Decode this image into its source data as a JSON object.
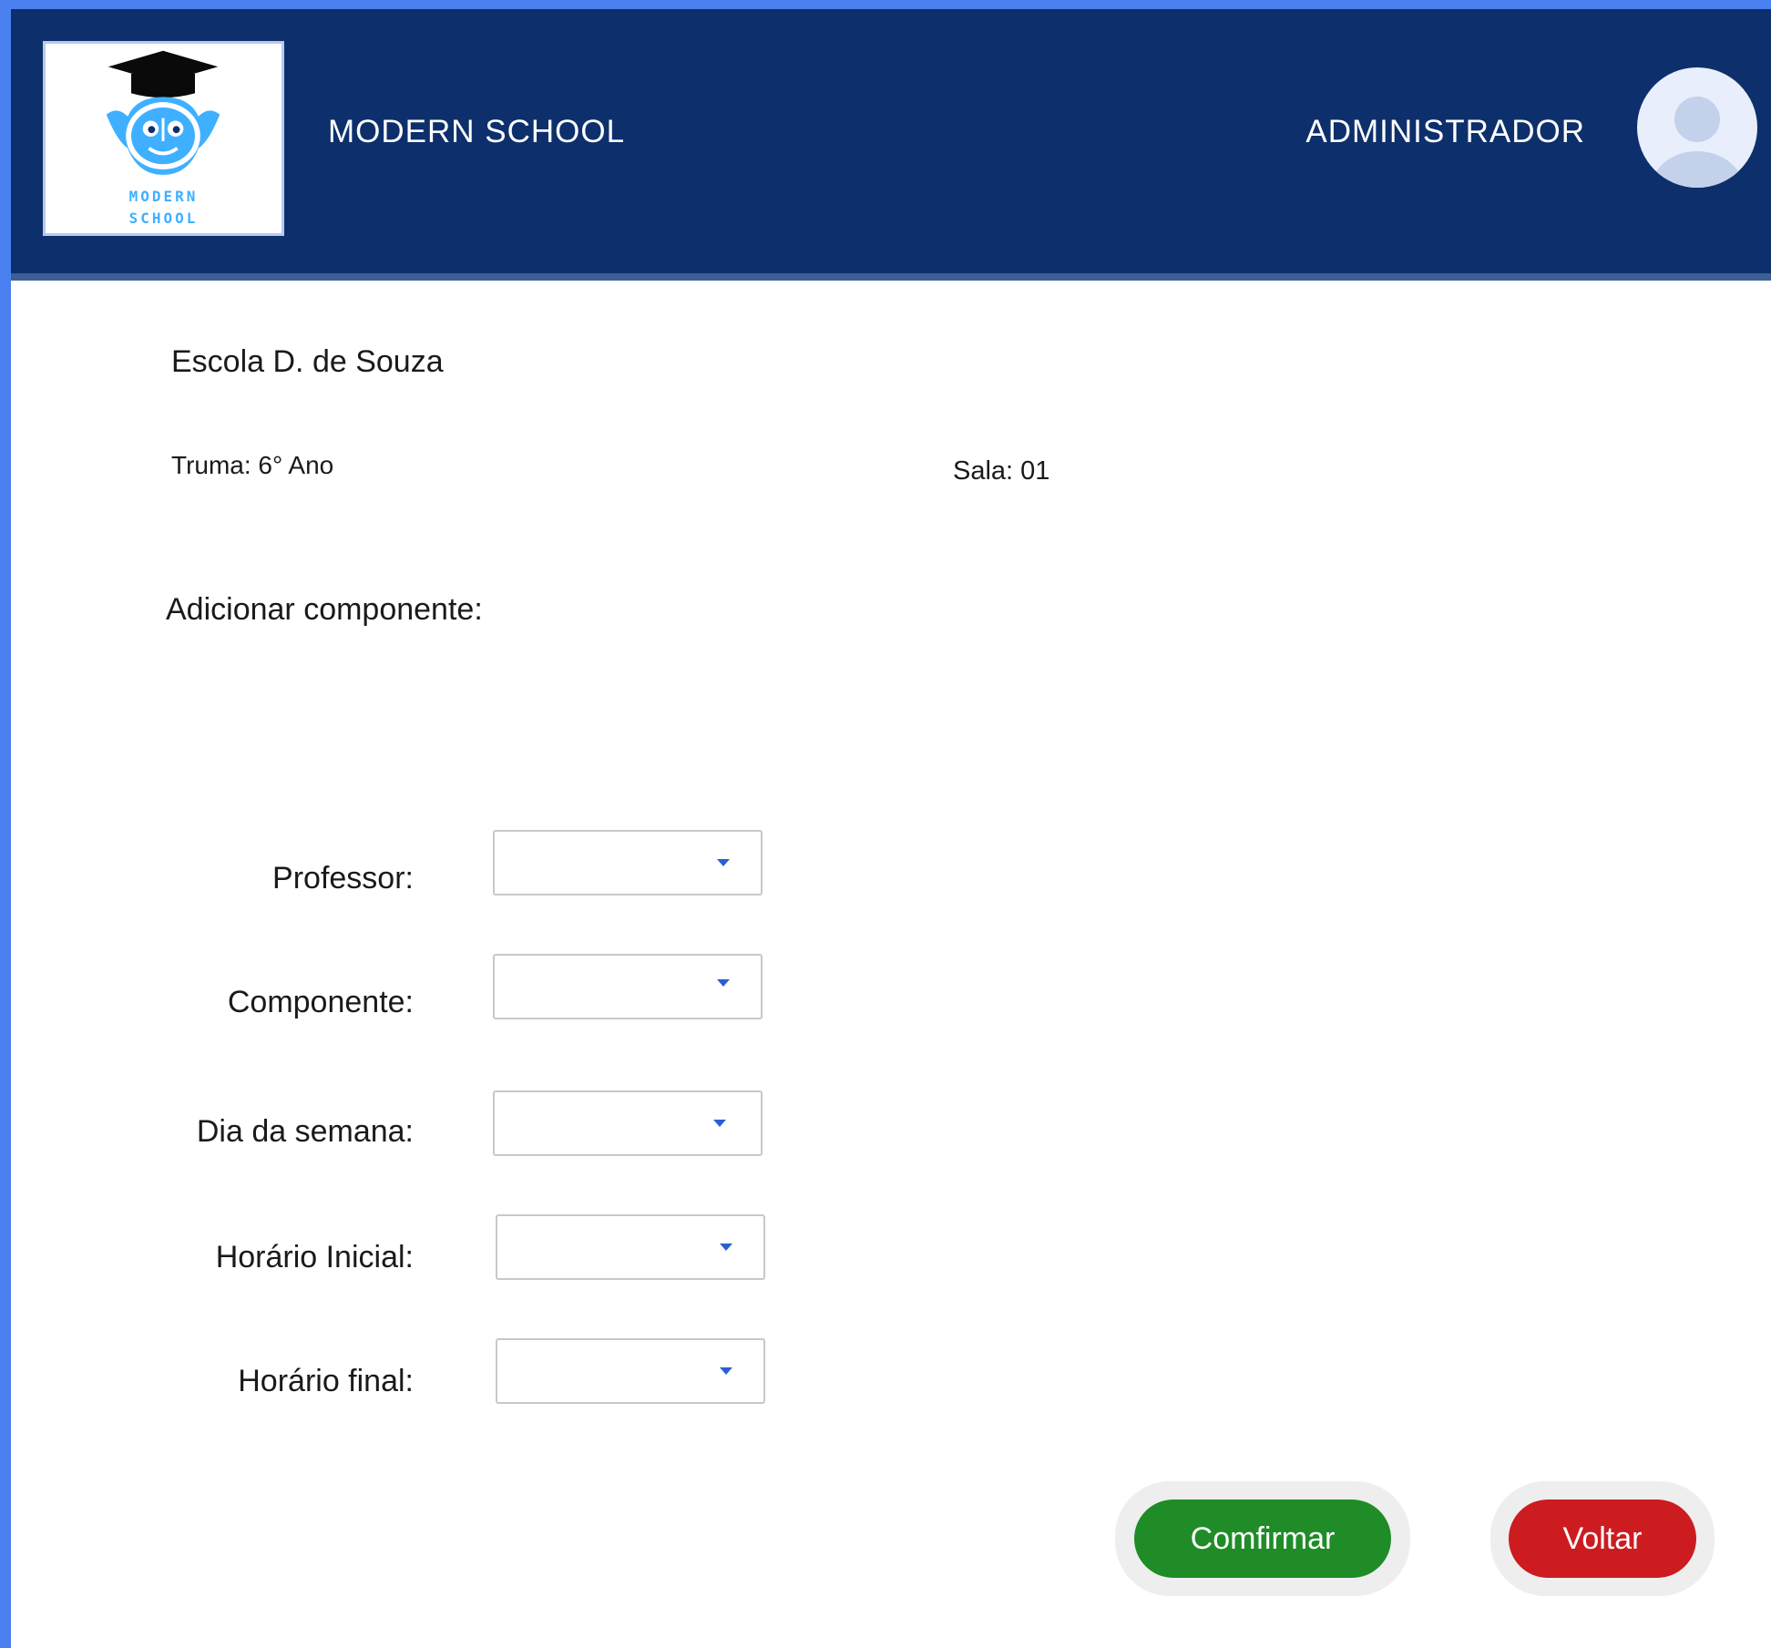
{
  "header": {
    "logo_line1": "MODERN",
    "logo_line2": "SCHOOL",
    "app_title": "MODERN SCHOOL",
    "user_role": "ADMINISTRADOR"
  },
  "info": {
    "school_name": "Escola D. de Souza",
    "turma": "Truma: 6° Ano",
    "sala": "Sala: 01"
  },
  "form": {
    "section_title": "Adicionar componente:",
    "fields": [
      {
        "label": "Professor:",
        "value": ""
      },
      {
        "label": "Componente:",
        "value": ""
      },
      {
        "label": "Dia da semana:",
        "value": ""
      },
      {
        "label": "Horário Inicial:",
        "value": ""
      },
      {
        "label": "Horário final:",
        "value": ""
      }
    ]
  },
  "actions": {
    "confirm_label": "Comfirmar",
    "back_label": "Voltar"
  },
  "colors": {
    "header_bg": "#0d306c",
    "confirm": "#1f8c27",
    "back": "#cc1c20",
    "caret": "#2a5fd3"
  }
}
